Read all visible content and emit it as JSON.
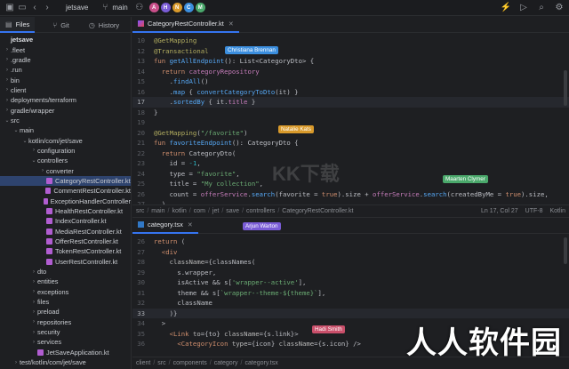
{
  "topbar": {
    "project": "jetsave",
    "branch": "main",
    "avatars": [
      {
        "letter": "A",
        "color": "#c94f8a"
      },
      {
        "letter": "H",
        "color": "#7a5cd6"
      },
      {
        "letter": "N",
        "color": "#d99a2b"
      },
      {
        "letter": "C",
        "color": "#3b8ede"
      },
      {
        "letter": "M",
        "color": "#4aa86b"
      }
    ],
    "accent": "#3574f0"
  },
  "sidebar": {
    "tabs": [
      {
        "label": "Files",
        "icon": "folder-icon"
      },
      {
        "label": "Git",
        "icon": "git-icon"
      },
      {
        "label": "History",
        "icon": "clock-icon"
      }
    ],
    "tree": [
      {
        "label": "jetsave",
        "depth": 0,
        "chev": "",
        "root": true
      },
      {
        "label": ".fleet",
        "depth": 0,
        "chev": "›"
      },
      {
        "label": ".gradle",
        "depth": 0,
        "chev": "›"
      },
      {
        "label": ".run",
        "depth": 0,
        "chev": "›"
      },
      {
        "label": "bin",
        "depth": 0,
        "chev": "›"
      },
      {
        "label": "client",
        "depth": 0,
        "chev": "›"
      },
      {
        "label": "deployments/terraform",
        "depth": 0,
        "chev": "›"
      },
      {
        "label": "gradle/wrapper",
        "depth": 0,
        "chev": "›"
      },
      {
        "label": "src",
        "depth": 0,
        "chev": "⌄"
      },
      {
        "label": "main",
        "depth": 1,
        "chev": "⌄"
      },
      {
        "label": "kotlin/com/jet/save",
        "depth": 2,
        "chev": "⌄"
      },
      {
        "label": "configuration",
        "depth": 3,
        "chev": "›"
      },
      {
        "label": "controllers",
        "depth": 3,
        "chev": "⌄"
      },
      {
        "label": "converter",
        "depth": 4,
        "chev": "›"
      },
      {
        "label": "CategoryRestController.kt",
        "depth": 4,
        "chev": "",
        "file": true,
        "selected": true
      },
      {
        "label": "CommentRestController.kt",
        "depth": 4,
        "chev": "",
        "file": true
      },
      {
        "label": "ExceptionHandlerController",
        "depth": 4,
        "chev": "",
        "file": true
      },
      {
        "label": "HealthRestController.kt",
        "depth": 4,
        "chev": "",
        "file": true
      },
      {
        "label": "IndexController.kt",
        "depth": 4,
        "chev": "",
        "file": true
      },
      {
        "label": "MediaRestController.kt",
        "depth": 4,
        "chev": "",
        "file": true
      },
      {
        "label": "OfferRestController.kt",
        "depth": 4,
        "chev": "",
        "file": true
      },
      {
        "label": "TokenRestController.kt",
        "depth": 4,
        "chev": "",
        "file": true
      },
      {
        "label": "UserRestController.kt",
        "depth": 4,
        "chev": "",
        "file": true
      },
      {
        "label": "dto",
        "depth": 3,
        "chev": "›"
      },
      {
        "label": "entities",
        "depth": 3,
        "chev": "›"
      },
      {
        "label": "exceptions",
        "depth": 3,
        "chev": "›"
      },
      {
        "label": "files",
        "depth": 3,
        "chev": "›"
      },
      {
        "label": "preload",
        "depth": 3,
        "chev": "›"
      },
      {
        "label": "repositories",
        "depth": 3,
        "chev": "›"
      },
      {
        "label": "security",
        "depth": 3,
        "chev": "›"
      },
      {
        "label": "services",
        "depth": 3,
        "chev": "›"
      },
      {
        "label": "JetSaveApplication.kt",
        "depth": 3,
        "chev": "",
        "file": true
      },
      {
        "label": "test/kotlin/com/jet/save",
        "depth": 1,
        "chev": "›"
      }
    ]
  },
  "editor1": {
    "tab": "CategoryRestController.kt",
    "breadcrumbs": [
      "src",
      "main",
      "kotlin",
      "com",
      "jet",
      "save",
      "controllers",
      "CategoryRestController.kt"
    ],
    "position": "Ln 17, Col 27",
    "encoding": "UTF-8",
    "language": "Kotlin",
    "lines": [
      {
        "n": "10",
        "html": "<span class='an'>@GetMapping</span>"
      },
      {
        "n": "12",
        "html": "<span class='an'>@Transactional</span>"
      },
      {
        "n": "13",
        "html": "<span class='k'>fun </span><span class='fn'>getAllEndpoint</span>(): List&lt;CategoryDto&gt; {"
      },
      {
        "n": "14",
        "html": "  <span class='k'>return </span><span class='ty'>categoryRepository</span>"
      },
      {
        "n": "15",
        "html": "    .<span class='fn'>findAll</span>()"
      },
      {
        "n": "16",
        "html": "    .<span class='fn'>map</span> { <span class='fn'>convertCategoryToDto</span>(it) }"
      },
      {
        "n": "17",
        "html": "    .<span class='fn'>sortedBy</span> { it.<span class='ty'>title</span> }",
        "cur": true
      },
      {
        "n": "18",
        "html": "}"
      },
      {
        "n": "19",
        "html": ""
      },
      {
        "n": "20",
        "html": "<span class='an'>@GetMapping</span>(<span class='s'>\"/favorite\"</span>)"
      },
      {
        "n": "21",
        "html": "<span class='k'>fun </span><span class='fn'>favoriteEndpoint</span>(): CategoryDto {"
      },
      {
        "n": "22",
        "html": "  <span class='k'>return </span>CategoryDto("
      },
      {
        "n": "23",
        "html": "    id = <span class='n'>-1</span>,"
      },
      {
        "n": "24",
        "html": "    type = <span class='s'>\"favorite\"</span>,"
      },
      {
        "n": "25",
        "html": "    title = <span class='s'>\"My collection\"</span>,"
      },
      {
        "n": "26",
        "html": "    count = <span class='ty'>offerService</span>.<span class='fn'>search</span>(favorite = <span class='k'>true</span>).size + <span class='ty'>offerService</span>.<span class='fn'>search</span>(createdByMe = <span class='k'>true</span>).size,"
      },
      {
        "n": "27",
        "html": "  )"
      }
    ],
    "cursors": [
      {
        "name": "Christiana Brennan",
        "color": "#3b8ede"
      },
      {
        "name": "Natalie Kats",
        "color": "#d99a2b"
      },
      {
        "name": "Maarten Clymer",
        "color": "#4aa86b"
      }
    ]
  },
  "editor2": {
    "tab": "category.tsx",
    "breadcrumbs": [
      "client",
      "src",
      "components",
      "category",
      "category.tsx"
    ],
    "lines": [
      {
        "n": "26",
        "html": "<span class='k'>return</span> ("
      },
      {
        "n": "27",
        "html": "  <span class='k'>&lt;div</span>"
      },
      {
        "n": "28",
        "html": "    <span class='at'>className</span>={classNames("
      },
      {
        "n": "29",
        "html": "      s.wrapper,"
      },
      {
        "n": "30",
        "html": "      isActive &amp;&amp; s[<span class='s'>'wrapper--active'</span>],"
      },
      {
        "n": "31",
        "html": "      theme &amp;&amp; s[<span class='s'>`wrapper--theme-${theme}`</span>],"
      },
      {
        "n": "32",
        "html": "      className"
      },
      {
        "n": "33",
        "html": "    )}",
        "cur": true
      },
      {
        "n": "34",
        "html": "  &gt;"
      },
      {
        "n": "35",
        "html": "    <span class='k'>&lt;Link</span> <span class='at'>to</span>={to} <span class='at'>className</span>={s.link}&gt;"
      },
      {
        "n": "36",
        "html": "      <span class='k'>&lt;CategoryIcon</span> <span class='at'>type</span>={icon} <span class='at'>className</span>={s.icon} /&gt;"
      }
    ],
    "cursors": [
      {
        "name": "Arjun Warton",
        "color": "#7a5cd6"
      },
      {
        "name": "Hadi Smith",
        "color": "#c94f6a"
      }
    ]
  },
  "watermark": "人人软件园",
  "faint_watermark": "KK下载"
}
